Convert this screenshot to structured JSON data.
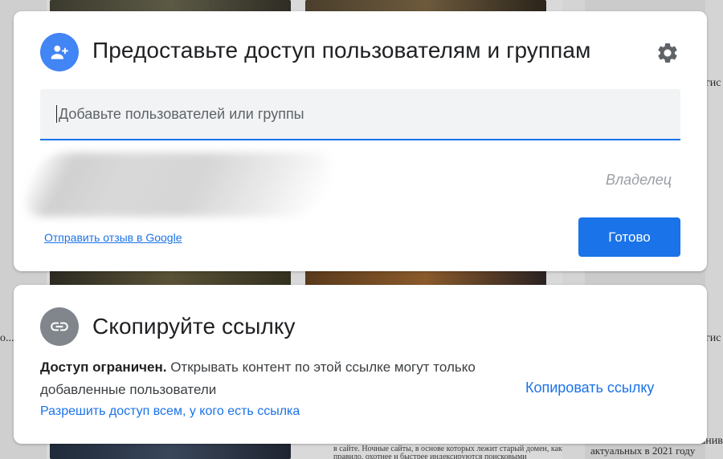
{
  "background": {
    "right_snippets": [
      "гис",
      "гис",
      "анива"
    ],
    "left_snippet": "о...",
    "bottom_caption": "актуальных в 2021 году",
    "body_lines": [
      "в сайте. Ночные сайты, в основе которых лежит старый домен, как",
      "правило, охотнее и быстрее индексируются поисковыми"
    ]
  },
  "share_dialog": {
    "title": "Предоставьте доступ пользователям и группам",
    "icon": "add-person-icon",
    "settings_icon": "gear-icon",
    "input": {
      "value": "",
      "placeholder": "Добавьте пользователей или группы"
    },
    "owner_role": "Владелец",
    "feedback_link": "Отправить отзыв в Google",
    "done_button": "Готово"
  },
  "link_dialog": {
    "title": "Скопируйте ссылку",
    "icon": "link-icon",
    "access_bold": "Доступ ограничен.",
    "access_rest": " Открывать контент по этой ссылке могут только добавленные пользователи",
    "allow_link": "Разрешить доступ всем, у кого есть ссылка",
    "copy_link": "Копировать ссылку"
  },
  "colors": {
    "primary": "#1a73e8",
    "share_icon_bg": "#4285f4",
    "link_icon_bg": "#80868b",
    "muted": "#9aa0a6"
  }
}
